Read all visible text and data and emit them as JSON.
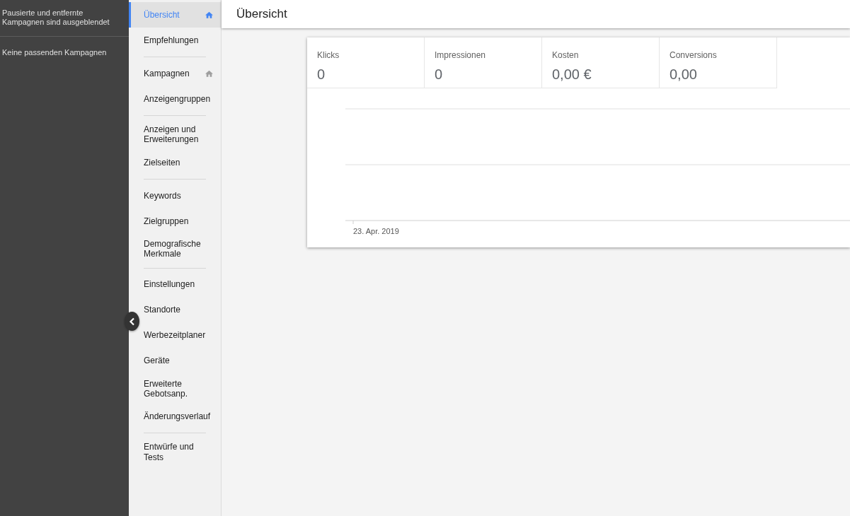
{
  "campaign_panel": {
    "notice": "Pausierte und entfernte Kampagnen sind ausgeblendet",
    "empty_text": "Keine passenden Kampagnen"
  },
  "nav_sections": [
    {
      "items": [
        {
          "label": "Übersicht",
          "selected": true,
          "home": true
        },
        {
          "label": "Empfehlungen",
          "selected": false,
          "home": false
        }
      ]
    },
    {
      "items": [
        {
          "label": "Kampagnen",
          "selected": false,
          "home": true
        },
        {
          "label": "Anzeigengruppen",
          "selected": false,
          "home": false
        }
      ]
    },
    {
      "items": [
        {
          "label": "Anzeigen und Erweiterungen",
          "selected": false,
          "home": false
        },
        {
          "label": "Zielseiten",
          "selected": false,
          "home": false
        }
      ]
    },
    {
      "items": [
        {
          "label": "Keywords",
          "selected": false,
          "home": false
        },
        {
          "label": "Zielgruppen",
          "selected": false,
          "home": false
        },
        {
          "label": "Demografische Merkmale",
          "selected": false,
          "home": false
        }
      ]
    },
    {
      "items": [
        {
          "label": "Einstellungen",
          "selected": false,
          "home": false
        },
        {
          "label": "Standorte",
          "selected": false,
          "home": false
        },
        {
          "label": "Werbezeitplaner",
          "selected": false,
          "home": false
        },
        {
          "label": "Geräte",
          "selected": false,
          "home": false
        },
        {
          "label": "Erweiterte Gebotsanp.",
          "selected": false,
          "home": false
        },
        {
          "label": "Änderungsverlauf",
          "selected": false,
          "home": false
        }
      ]
    },
    {
      "items": [
        {
          "label": "Entwürfe und Tests",
          "selected": false,
          "home": false
        }
      ]
    }
  ],
  "page_title": "Übersicht",
  "metrics": [
    {
      "label": "Klicks",
      "value": "0"
    },
    {
      "label": "Impressionen",
      "value": "0"
    },
    {
      "label": "Kosten",
      "value": "0,00 €"
    },
    {
      "label": "Conversions",
      "value": "0,00"
    }
  ],
  "chart": {
    "date_label": "23. Apr. 2019"
  }
}
